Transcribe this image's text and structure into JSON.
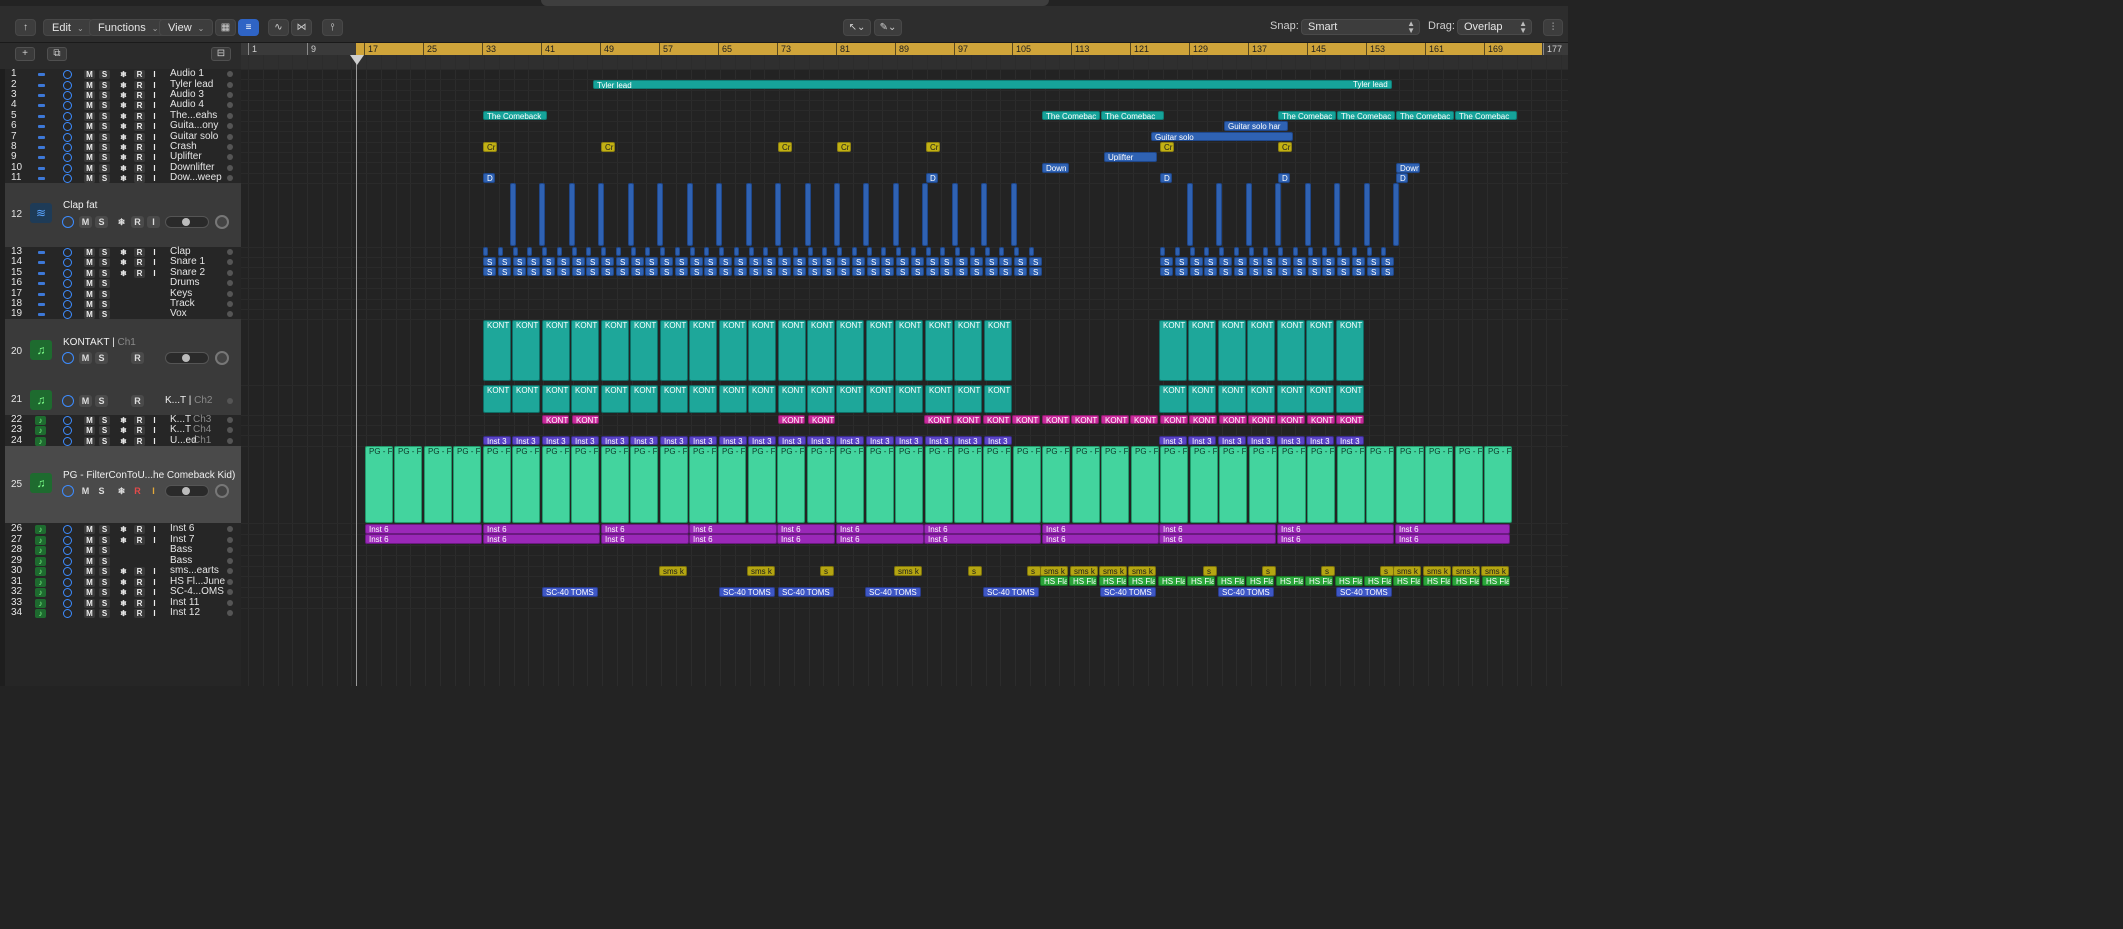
{
  "toolbar": {
    "edit": "Edit",
    "functions": "Functions",
    "view": "View",
    "snap_label": "Snap:",
    "snap_value": "Smart",
    "drag_label": "Drag:",
    "drag_value": "Overlap"
  },
  "ruler": {
    "bars": [
      "1",
      "9",
      "17",
      "25",
      "33",
      "41",
      "49",
      "57",
      "65",
      "73",
      "81",
      "89",
      "97",
      "105",
      "113",
      "121",
      "129",
      "137",
      "145",
      "153",
      "161",
      "169",
      "177"
    ],
    "cycle_color": "#cfa43a"
  },
  "tracks": [
    {
      "num": "1",
      "name": "Audio 1"
    },
    {
      "num": "2",
      "name": "Tyler lead"
    },
    {
      "num": "3",
      "name": "Audio 3"
    },
    {
      "num": "4",
      "name": "Audio 4"
    },
    {
      "num": "5",
      "name": "The...eahs"
    },
    {
      "num": "6",
      "name": "Guita...ony"
    },
    {
      "num": "7",
      "name": "Guitar solo"
    },
    {
      "num": "8",
      "name": "Crash"
    },
    {
      "num": "9",
      "name": "Uplifter"
    },
    {
      "num": "10",
      "name": "Downlifter"
    },
    {
      "num": "11",
      "name": "Dow...weep"
    },
    {
      "num": "12",
      "name": "Clap fat"
    },
    {
      "num": "13",
      "name": "Clap"
    },
    {
      "num": "14",
      "name": "Snare 1"
    },
    {
      "num": "15",
      "name": "Snare 2"
    },
    {
      "num": "16",
      "name": "Drums"
    },
    {
      "num": "17",
      "name": "Keys"
    },
    {
      "num": "18",
      "name": "Track"
    },
    {
      "num": "19",
      "name": "Vox"
    },
    {
      "num": "20",
      "name": "KONTAKT",
      "ch": "Ch1"
    },
    {
      "num": "21",
      "name": "K...T",
      "ch": "Ch2"
    },
    {
      "num": "22",
      "name": "K...T",
      "ch": "Ch3"
    },
    {
      "num": "23",
      "name": "K...T",
      "ch": "Ch4"
    },
    {
      "num": "24",
      "name": "U...ed",
      "ch": "Ch1"
    },
    {
      "num": "25",
      "name": "PG - FilterConToU...he Comeback Kid)"
    },
    {
      "num": "26",
      "name": "Inst 6"
    },
    {
      "num": "27",
      "name": "Inst 7"
    },
    {
      "num": "28",
      "name": "Bass"
    },
    {
      "num": "29",
      "name": "Bass"
    },
    {
      "num": "30",
      "name": "sms...earts"
    },
    {
      "num": "31",
      "name": "HS Fl...June"
    },
    {
      "num": "32",
      "name": "SC-4...OMS"
    },
    {
      "num": "33",
      "name": "Inst 11"
    },
    {
      "num": "34",
      "name": "Inst 12"
    }
  ],
  "regions": {
    "tyler_lead": "Tyler lead",
    "tyler_lead_end": "Tyler lead",
    "comeback": "The Comeback",
    "comeback_short": "The Comebac",
    "guitar_solo": "Guitar solo",
    "guitar_solo_har": "Guitar solo har",
    "crash": "Cr",
    "uplifter": "Uplifter",
    "down": "Down",
    "d": "D",
    "kont": "KONT",
    "inst3": "Inst 3",
    "pg": "PG - F",
    "inst6": "Inst 6",
    "sms": "sms k",
    "s": "s",
    "hsfla": "HS Fla",
    "sc40": "SC-40 TOMS",
    "snare_s": "S"
  }
}
